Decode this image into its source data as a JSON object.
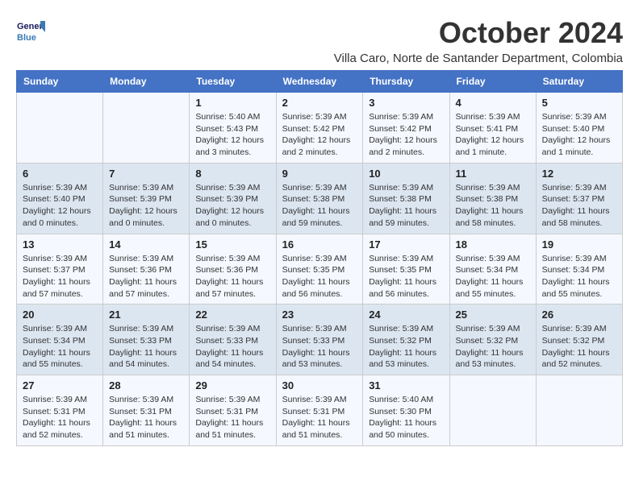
{
  "header": {
    "logo_line1": "General",
    "logo_line2": "Blue",
    "month_title": "October 2024",
    "location": "Villa Caro, Norte de Santander Department, Colombia"
  },
  "days_of_week": [
    "Sunday",
    "Monday",
    "Tuesday",
    "Wednesday",
    "Thursday",
    "Friday",
    "Saturday"
  ],
  "weeks": [
    [
      {
        "day": "",
        "info": ""
      },
      {
        "day": "",
        "info": ""
      },
      {
        "day": "1",
        "info": "Sunrise: 5:40 AM\nSunset: 5:43 PM\nDaylight: 12 hours and 3 minutes."
      },
      {
        "day": "2",
        "info": "Sunrise: 5:39 AM\nSunset: 5:42 PM\nDaylight: 12 hours and 2 minutes."
      },
      {
        "day": "3",
        "info": "Sunrise: 5:39 AM\nSunset: 5:42 PM\nDaylight: 12 hours and 2 minutes."
      },
      {
        "day": "4",
        "info": "Sunrise: 5:39 AM\nSunset: 5:41 PM\nDaylight: 12 hours and 1 minute."
      },
      {
        "day": "5",
        "info": "Sunrise: 5:39 AM\nSunset: 5:40 PM\nDaylight: 12 hours and 1 minute."
      }
    ],
    [
      {
        "day": "6",
        "info": "Sunrise: 5:39 AM\nSunset: 5:40 PM\nDaylight: 12 hours and 0 minutes."
      },
      {
        "day": "7",
        "info": "Sunrise: 5:39 AM\nSunset: 5:39 PM\nDaylight: 12 hours and 0 minutes."
      },
      {
        "day": "8",
        "info": "Sunrise: 5:39 AM\nSunset: 5:39 PM\nDaylight: 12 hours and 0 minutes."
      },
      {
        "day": "9",
        "info": "Sunrise: 5:39 AM\nSunset: 5:38 PM\nDaylight: 11 hours and 59 minutes."
      },
      {
        "day": "10",
        "info": "Sunrise: 5:39 AM\nSunset: 5:38 PM\nDaylight: 11 hours and 59 minutes."
      },
      {
        "day": "11",
        "info": "Sunrise: 5:39 AM\nSunset: 5:38 PM\nDaylight: 11 hours and 58 minutes."
      },
      {
        "day": "12",
        "info": "Sunrise: 5:39 AM\nSunset: 5:37 PM\nDaylight: 11 hours and 58 minutes."
      }
    ],
    [
      {
        "day": "13",
        "info": "Sunrise: 5:39 AM\nSunset: 5:37 PM\nDaylight: 11 hours and 57 minutes."
      },
      {
        "day": "14",
        "info": "Sunrise: 5:39 AM\nSunset: 5:36 PM\nDaylight: 11 hours and 57 minutes."
      },
      {
        "day": "15",
        "info": "Sunrise: 5:39 AM\nSunset: 5:36 PM\nDaylight: 11 hours and 57 minutes."
      },
      {
        "day": "16",
        "info": "Sunrise: 5:39 AM\nSunset: 5:35 PM\nDaylight: 11 hours and 56 minutes."
      },
      {
        "day": "17",
        "info": "Sunrise: 5:39 AM\nSunset: 5:35 PM\nDaylight: 11 hours and 56 minutes."
      },
      {
        "day": "18",
        "info": "Sunrise: 5:39 AM\nSunset: 5:34 PM\nDaylight: 11 hours and 55 minutes."
      },
      {
        "day": "19",
        "info": "Sunrise: 5:39 AM\nSunset: 5:34 PM\nDaylight: 11 hours and 55 minutes."
      }
    ],
    [
      {
        "day": "20",
        "info": "Sunrise: 5:39 AM\nSunset: 5:34 PM\nDaylight: 11 hours and 55 minutes."
      },
      {
        "day": "21",
        "info": "Sunrise: 5:39 AM\nSunset: 5:33 PM\nDaylight: 11 hours and 54 minutes."
      },
      {
        "day": "22",
        "info": "Sunrise: 5:39 AM\nSunset: 5:33 PM\nDaylight: 11 hours and 54 minutes."
      },
      {
        "day": "23",
        "info": "Sunrise: 5:39 AM\nSunset: 5:33 PM\nDaylight: 11 hours and 53 minutes."
      },
      {
        "day": "24",
        "info": "Sunrise: 5:39 AM\nSunset: 5:32 PM\nDaylight: 11 hours and 53 minutes."
      },
      {
        "day": "25",
        "info": "Sunrise: 5:39 AM\nSunset: 5:32 PM\nDaylight: 11 hours and 53 minutes."
      },
      {
        "day": "26",
        "info": "Sunrise: 5:39 AM\nSunset: 5:32 PM\nDaylight: 11 hours and 52 minutes."
      }
    ],
    [
      {
        "day": "27",
        "info": "Sunrise: 5:39 AM\nSunset: 5:31 PM\nDaylight: 11 hours and 52 minutes."
      },
      {
        "day": "28",
        "info": "Sunrise: 5:39 AM\nSunset: 5:31 PM\nDaylight: 11 hours and 51 minutes."
      },
      {
        "day": "29",
        "info": "Sunrise: 5:39 AM\nSunset: 5:31 PM\nDaylight: 11 hours and 51 minutes."
      },
      {
        "day": "30",
        "info": "Sunrise: 5:39 AM\nSunset: 5:31 PM\nDaylight: 11 hours and 51 minutes."
      },
      {
        "day": "31",
        "info": "Sunrise: 5:40 AM\nSunset: 5:30 PM\nDaylight: 11 hours and 50 minutes."
      },
      {
        "day": "",
        "info": ""
      },
      {
        "day": "",
        "info": ""
      }
    ]
  ]
}
